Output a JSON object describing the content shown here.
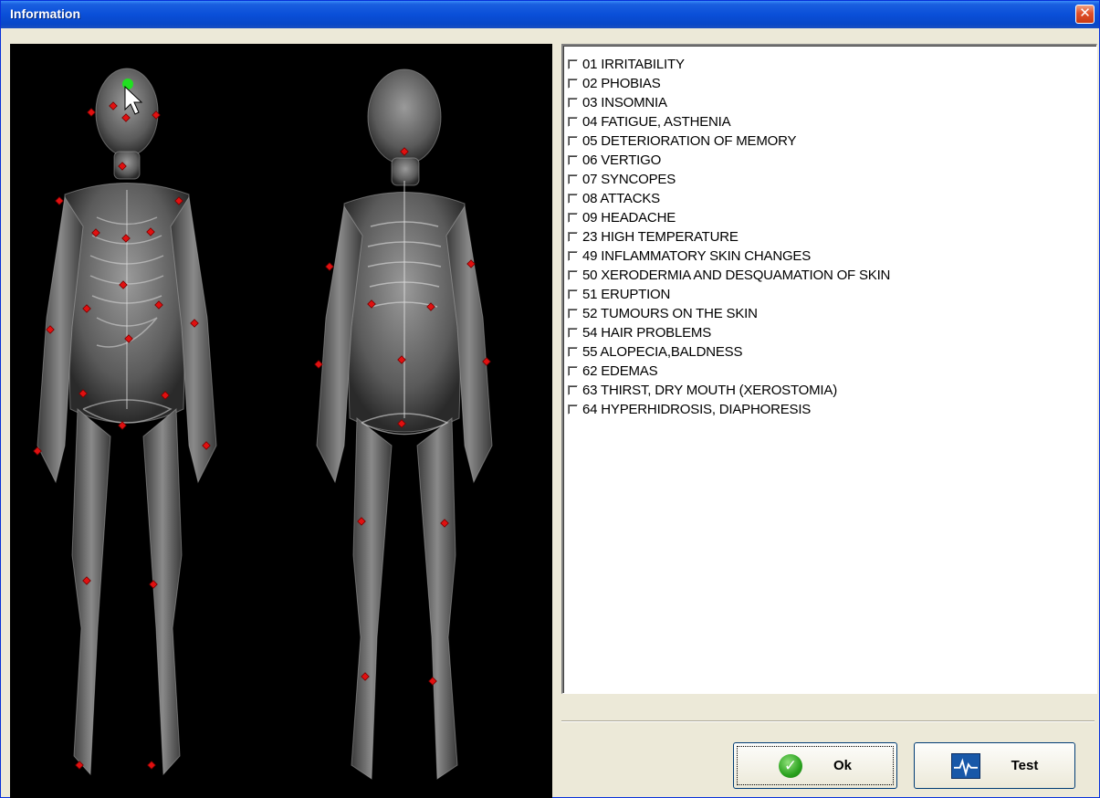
{
  "window": {
    "title": "Information",
    "close_glyph": "✕"
  },
  "symptoms": [
    {
      "label": "01 IRRITABILITY",
      "checked": false
    },
    {
      "label": "02 PHOBIAS",
      "checked": false
    },
    {
      "label": "03 INSOMNIA",
      "checked": false
    },
    {
      "label": "04 FATIGUE, ASTHENIA",
      "checked": false
    },
    {
      "label": "05 DETERIORATION OF MEMORY",
      "checked": false
    },
    {
      "label": "06 VERTIGO",
      "checked": false
    },
    {
      "label": "07 SYNCOPES",
      "checked": false
    },
    {
      "label": "08 ATTACKS",
      "checked": false
    },
    {
      "label": "09 HEADACHE",
      "checked": false
    },
    {
      "label": "23 HIGH TEMPERATURE",
      "checked": false
    },
    {
      "label": "49 INFLAMMATORY SKIN CHANGES",
      "checked": false
    },
    {
      "label": "50 XERODERMIA AND DESQUAMATION OF SKIN",
      "checked": false
    },
    {
      "label": "51 ERUPTION",
      "checked": false
    },
    {
      "label": "52 TUMOURS ON THE SKIN",
      "checked": false
    },
    {
      "label": "54 HAIR PROBLEMS",
      "checked": false
    },
    {
      "label": "55 ALOPECIA,BALDNESS",
      "checked": false
    },
    {
      "label": "62 EDEMAS",
      "checked": false
    },
    {
      "label": "63 THIRST, DRY MOUTH (XEROSTOMIA)",
      "checked": false
    },
    {
      "label": "64 HYPERHIDROSIS, DIAPHORESIS",
      "checked": false
    }
  ],
  "buttons": {
    "ok_label": "Ok",
    "ok_icon": "check-icon",
    "test_label": "Test",
    "test_icon": "monitor-pulse-icon"
  },
  "colors": {
    "title_bar": "#0a4fd8",
    "point_marker": "#e01010",
    "selected_marker": "#20e020"
  }
}
